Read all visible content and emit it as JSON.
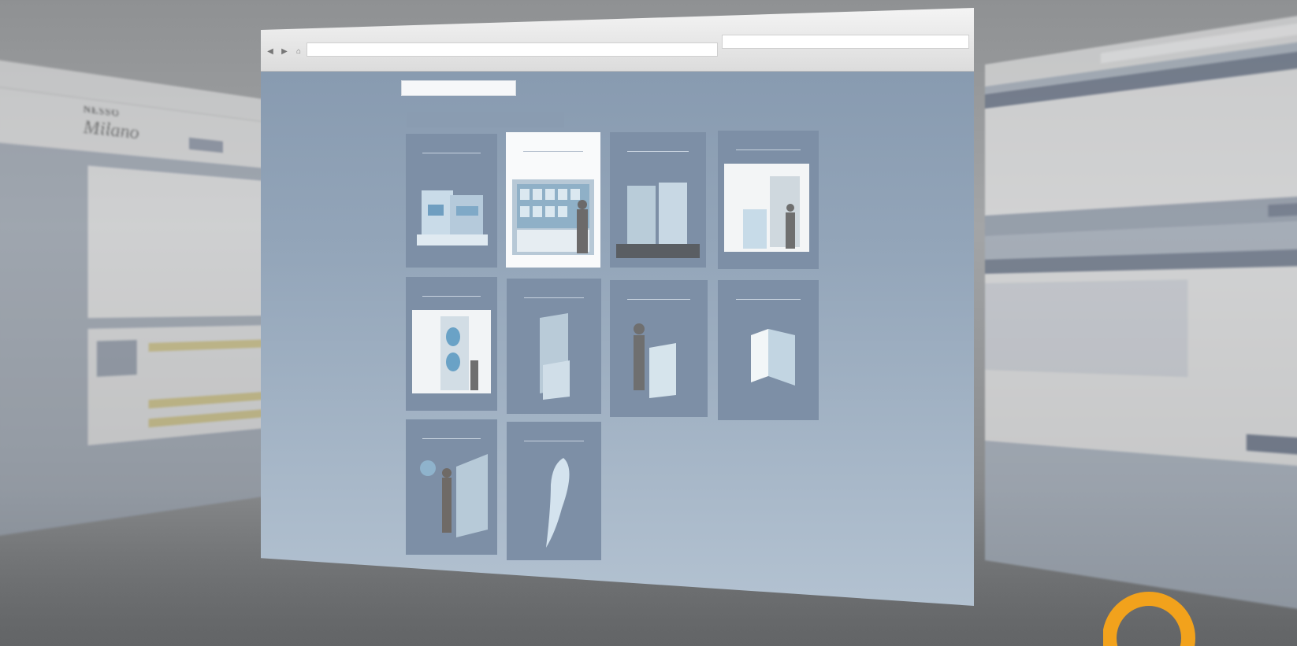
{
  "background_windows": {
    "left": {
      "logo_line1": "NESSO",
      "logo_line2": "Milano"
    },
    "right": {}
  },
  "main_window": {
    "nav_icons": [
      "back-arrow-icon",
      "forward-arrow-icon",
      "home-icon"
    ],
    "products": [
      {
        "id": "p1",
        "title": "",
        "selected": false
      },
      {
        "id": "p2",
        "title": "",
        "selected": true
      },
      {
        "id": "p3",
        "title": "",
        "selected": false
      },
      {
        "id": "p4",
        "title": "",
        "selected": false
      },
      {
        "id": "p5",
        "title": "",
        "selected": false
      },
      {
        "id": "p6",
        "title": "",
        "selected": false
      },
      {
        "id": "p7",
        "title": "",
        "selected": false
      },
      {
        "id": "p8",
        "title": "",
        "selected": false
      },
      {
        "id": "p9",
        "title": "",
        "selected": false
      },
      {
        "id": "p10",
        "title": "",
        "selected": false
      }
    ]
  },
  "colors": {
    "tile": "#7d8fa6",
    "tile_selected": "#f9fafb",
    "content_bg": "#8497ad",
    "accent_orange": "#f2a21c"
  }
}
